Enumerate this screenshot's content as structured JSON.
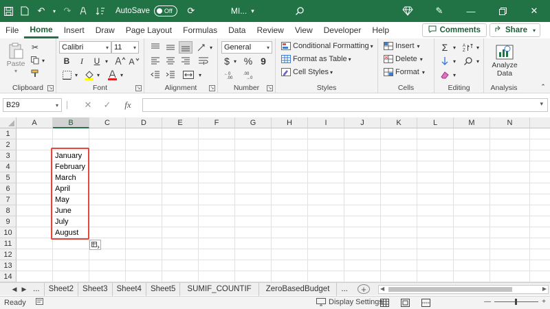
{
  "titlebar": {
    "autosave_label": "AutoSave",
    "autosave_state": "Off",
    "filename": "MI...",
    "bg_color": "#217346"
  },
  "menu": [
    "File",
    "Home",
    "Insert",
    "Draw",
    "Page Layout",
    "Formulas",
    "Data",
    "Review",
    "View",
    "Developer",
    "Help"
  ],
  "menu_active": "Home",
  "comments_label": "Comments",
  "share_label": "Share",
  "ribbon": {
    "clipboard": {
      "label": "Clipboard",
      "paste": "Paste"
    },
    "font": {
      "label": "Font",
      "name": "Calibri",
      "size": "11",
      "bold": "B",
      "italic": "I",
      "underline": "U"
    },
    "alignment": {
      "label": "Alignment"
    },
    "number": {
      "label": "Number",
      "format": "General",
      "currency": "$",
      "percent": "%",
      "comma": "9"
    },
    "styles": {
      "label": "Styles",
      "conditional": "Conditional Formatting",
      "table": "Format as Table",
      "cell": "Cell Styles"
    },
    "cells": {
      "label": "Cells",
      "insert": "Insert",
      "delete": "Delete",
      "format": "Format"
    },
    "editing": {
      "label": "Editing"
    },
    "analysis": {
      "label": "Analysis",
      "analyze": "Analyze",
      "data": "Data"
    }
  },
  "formula_bar": {
    "name_box": "B29",
    "fx": "fx",
    "cancel": "✕",
    "enter": "✓",
    "value": ""
  },
  "columns": [
    "A",
    "B",
    "C",
    "D",
    "E",
    "F",
    "G",
    "H",
    "I",
    "J",
    "K",
    "L",
    "M",
    "N"
  ],
  "selected_column": "B",
  "rows": [
    "1",
    "2",
    "3",
    "4",
    "5",
    "6",
    "7",
    "8",
    "9",
    "10",
    "11",
    "12",
    "13",
    "14"
  ],
  "cells_b": [
    "January",
    "February",
    "March",
    "April",
    "May",
    "June",
    "July",
    "August"
  ],
  "highlight_color": "#e0483e",
  "sheet_tabs": [
    "...",
    "Sheet2",
    "Sheet3",
    "Sheet4",
    "Sheet5",
    "SUMIF_COUNTIF",
    "ZeroBasedBudget",
    "..."
  ],
  "status": {
    "ready": "Ready",
    "display_settings": "Display Settings"
  }
}
